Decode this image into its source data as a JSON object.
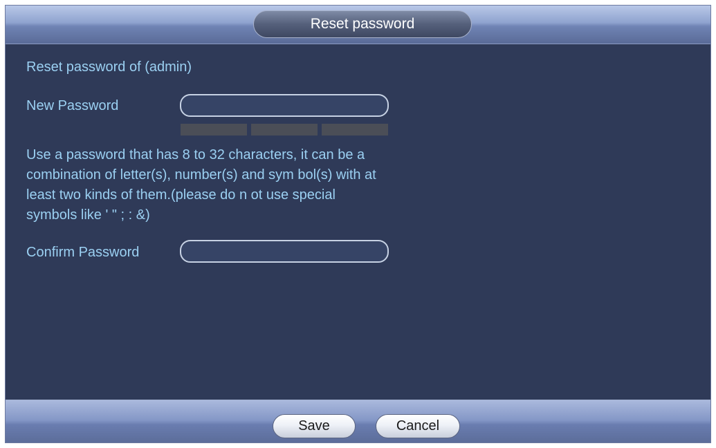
{
  "dialog": {
    "title": "Reset password"
  },
  "form": {
    "heading": "Reset password of (admin)",
    "new_password_label": "New Password",
    "new_password_value": "",
    "strength_segments": 3,
    "hint": "Use a password that has 8 to 32 characters, it can be a combination of letter(s), number(s) and sym bol(s) with at least two kinds of them.(please do n ot use special symbols like ' \" ; : &)",
    "confirm_password_label": "Confirm Password",
    "confirm_password_value": ""
  },
  "footer": {
    "save_label": "Save",
    "cancel_label": "Cancel"
  },
  "colors": {
    "background": "#2f3a58",
    "text": "#9bd0f2",
    "strength_empty": "#4b4e57"
  }
}
